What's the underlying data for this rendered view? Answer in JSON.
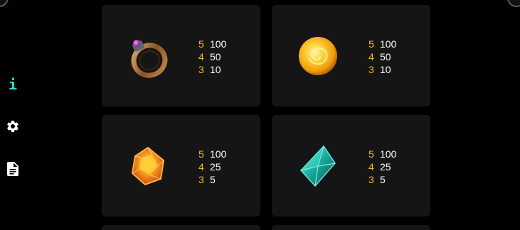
{
  "menu": {
    "info_label": "i",
    "icons": [
      "info-icon",
      "gear-icon",
      "document-icon"
    ],
    "accent_color": "#27e0d0"
  },
  "paytable": {
    "count_color": "#f5b82e",
    "value_color": "#ffffff",
    "symbols": [
      {
        "symbol_name": "ring",
        "rows": [
          {
            "count": "5",
            "value": "100"
          },
          {
            "count": "4",
            "value": "50"
          },
          {
            "count": "3",
            "value": "10"
          }
        ]
      },
      {
        "symbol_name": "gold-orb",
        "rows": [
          {
            "count": "5",
            "value": "100"
          },
          {
            "count": "4",
            "value": "50"
          },
          {
            "count": "3",
            "value": "10"
          }
        ]
      },
      {
        "symbol_name": "amber-gem",
        "rows": [
          {
            "count": "5",
            "value": "100"
          },
          {
            "count": "4",
            "value": "25"
          },
          {
            "count": "3",
            "value": "5"
          }
        ]
      },
      {
        "symbol_name": "teal-crystal",
        "rows": [
          {
            "count": "5",
            "value": "100"
          },
          {
            "count": "4",
            "value": "25"
          },
          {
            "count": "3",
            "value": "5"
          }
        ]
      }
    ]
  }
}
